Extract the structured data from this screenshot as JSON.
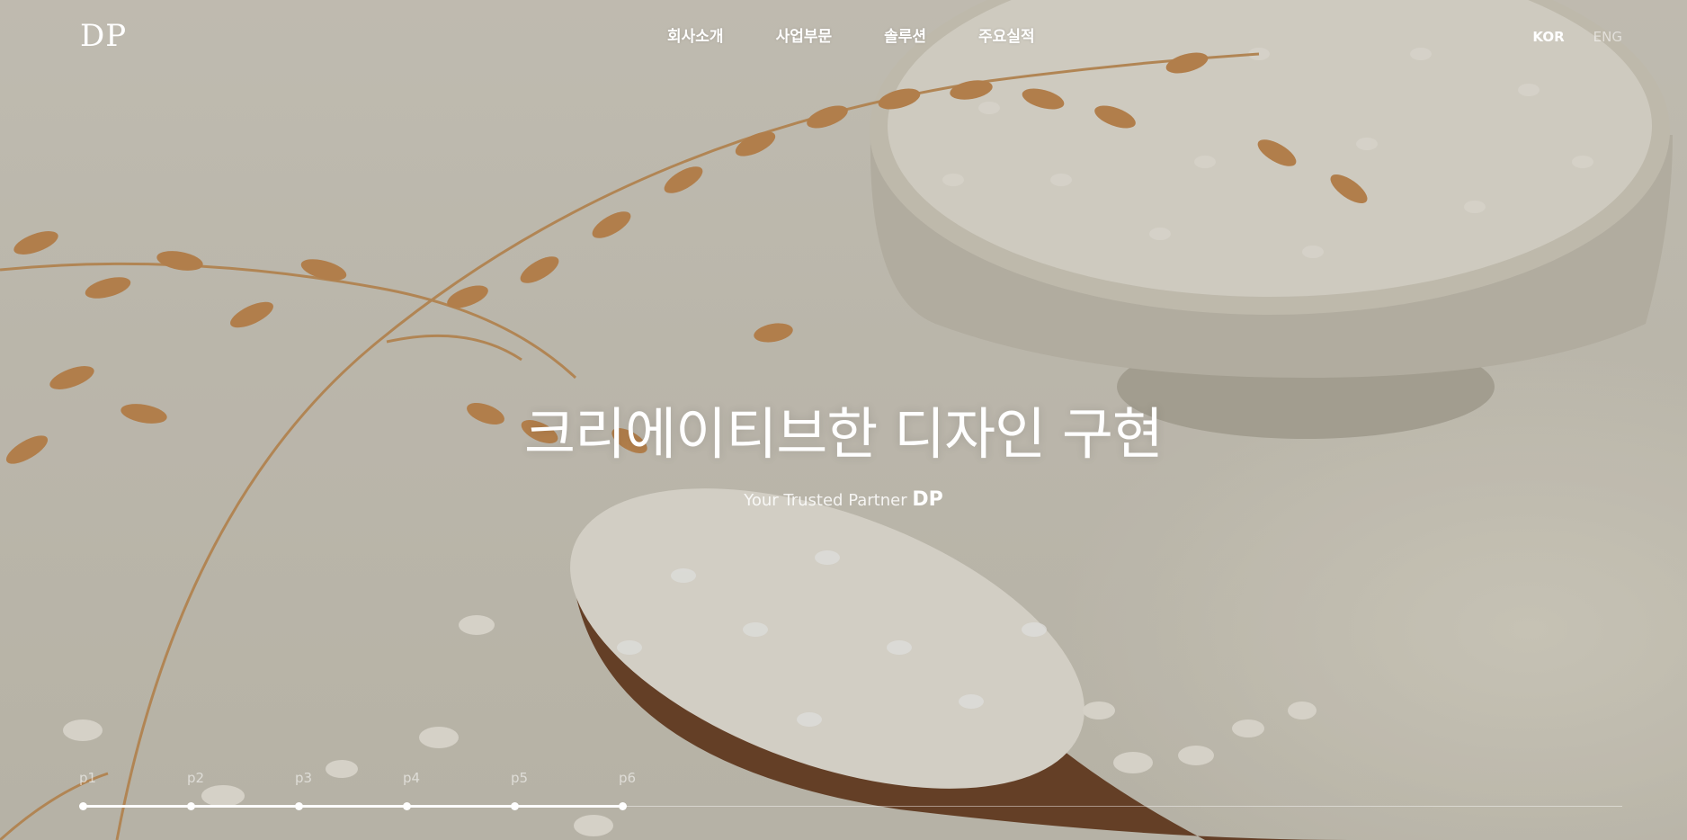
{
  "header": {
    "logo": "DP",
    "nav": [
      {
        "label": "회사소개"
      },
      {
        "label": "사업부문"
      },
      {
        "label": "솔루션"
      },
      {
        "label": "주요실적"
      }
    ],
    "lang": {
      "kor": "KOR",
      "eng": "ENG"
    }
  },
  "hero": {
    "headline": "크리에이티브한 디자인 구현",
    "tagline_prefix": "Your Trusted Partner",
    "tagline_brand": "DP"
  },
  "pagination": {
    "steps": [
      "p1",
      "p2",
      "p3",
      "p4",
      "p5",
      "p6"
    ],
    "current": 6,
    "progress": 0.35
  },
  "colors": {
    "text": "#ffffff",
    "background": "#d8d3c6",
    "wood": "#6b3d22",
    "grain": "#f3eee4",
    "stalk": "#c9935a"
  }
}
